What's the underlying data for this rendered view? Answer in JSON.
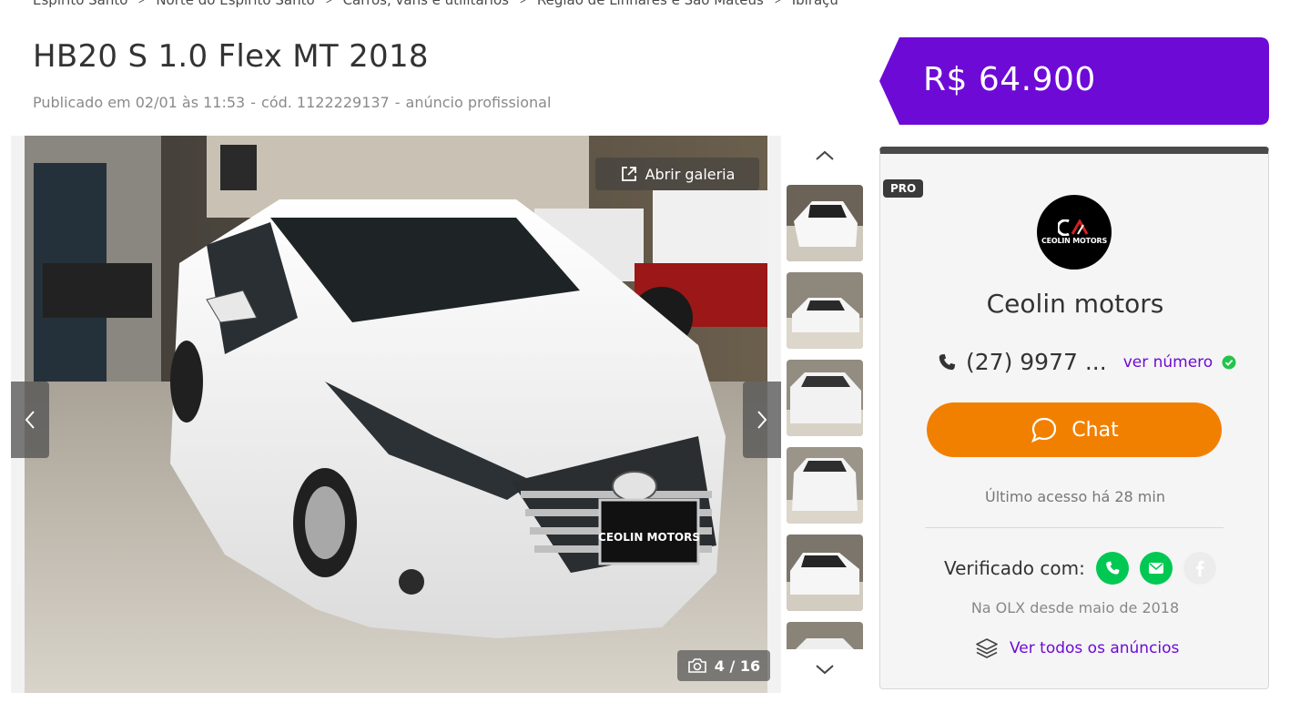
{
  "breadcrumb": [
    "Espírito Santo",
    "Norte do Espírito Santo",
    "Carros, vans e utilitários",
    "Região de Linhares e São Mateus",
    "Ibiraçu"
  ],
  "listing": {
    "title": "HB20 S 1.0 Flex MT 2018",
    "published": "Publicado em 02/01 às 11:53",
    "code": "cód. 1122229137",
    "type": "anúncio profissional"
  },
  "gallery": {
    "open_label": "Abrir galeria",
    "counter": "4 / 16",
    "photo_plate": "CEOLIN MOTORS"
  },
  "price": {
    "value": "R$ 64.900",
    "color": "#6e0ad6"
  },
  "seller": {
    "badge": "PRO",
    "logo_text": "CEOLIN MOTORS",
    "name": "Ceolin motors",
    "phone": "(27) 9977 ...",
    "show_number": "ver número",
    "chat_label": "Chat",
    "last_access": "Último acesso há 28 min",
    "verified_label": "Verificado com:",
    "since": "Na OLX desde maio de 2018",
    "all_ads": "Ver todos os anúncios"
  },
  "colors": {
    "accent": "#6e0ad6",
    "chat": "#f28000",
    "verified_green": "#00c853"
  }
}
